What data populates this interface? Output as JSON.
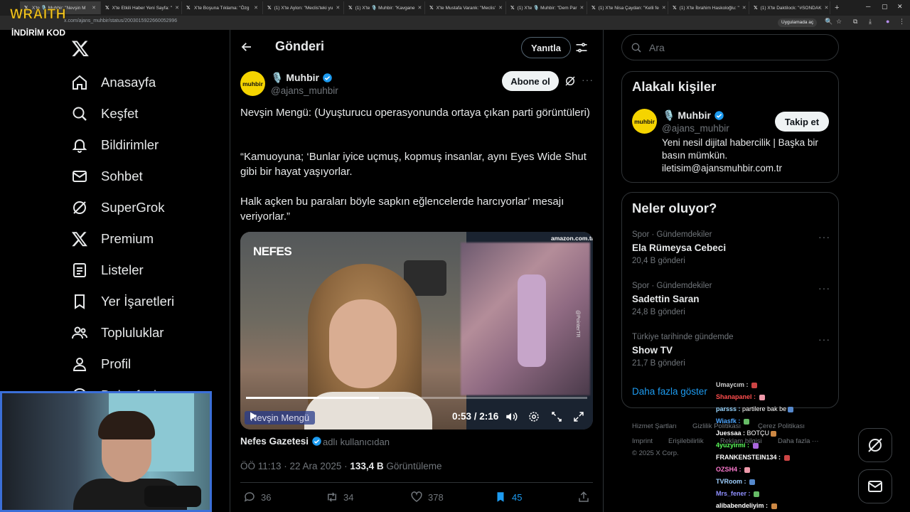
{
  "browser": {
    "tabs": [
      {
        "title": "X'te 🎙️ Muhbir: \"Nevşin M"
      },
      {
        "title": "X'te Etkili Haber Yeni Sayfa: \""
      },
      {
        "title": "X'te Boşuna Tıklama: \"Özg"
      },
      {
        "title": "(1) X'te Aylon: \"Meclis'teki yu"
      },
      {
        "title": "(1) X'te 🎙️ Muhbir: \"Kavgane"
      },
      {
        "title": "X'te Mustafa Varank: \"Meclis'"
      },
      {
        "title": "(1) X'te 🎙️ Muhbir: \"Dem Par"
      },
      {
        "title": "(1) X'te Nisa Çaydan: \"Kelli fe"
      },
      {
        "title": "(1) X'te İbrahim Haskoloğlu: \""
      },
      {
        "title": "(1) X'te Daktilock: \"#SONDAK"
      }
    ],
    "new_tab": "+",
    "url": "x.com/ajans_muhbir/status/2003015922660052996",
    "install_label": "Uygulamada aç"
  },
  "overlay": {
    "brand": "WRAITH",
    "code_label": "İNDİRİM KOD"
  },
  "nav": {
    "items": [
      {
        "label": "Anasayfa",
        "icon": "home-icon"
      },
      {
        "label": "Keşfet",
        "icon": "search-icon"
      },
      {
        "label": "Bildirimler",
        "icon": "bell-icon"
      },
      {
        "label": "Sohbet",
        "icon": "mail-icon"
      },
      {
        "label": "SuperGrok",
        "icon": "grok-icon"
      },
      {
        "label": "Premium",
        "icon": "x-icon"
      },
      {
        "label": "Listeler",
        "icon": "list-icon"
      },
      {
        "label": "Yer İşaretleri",
        "icon": "bookmark-icon"
      },
      {
        "label": "Topluluklar",
        "icon": "people-icon"
      },
      {
        "label": "Profil",
        "icon": "user-icon"
      },
      {
        "label": "Daha fazla",
        "icon": "more-icon"
      }
    ]
  },
  "header": {
    "title": "Gönderi",
    "reply_label": "Yanıtla"
  },
  "post": {
    "author_name": "🎙️ Muhbir",
    "author_handle": "@ajans_muhbir",
    "avatar_text": "muhbir",
    "subscribe_label": "Abone ol",
    "paragraphs": [
      "Nevşin Mengü: (Uyuşturucu operasyonunda ortaya çıkan parti görüntüleri)",
      "“Kamuoyuna; ‘Bunlar iyice uçmuş, kopmuş insanlar, aynı Eyes Wide Shut gibi bir hayat yaşıyorlar.",
      "Halk açken bu paraları böyle sapkın eğlencelerde harcıyorlar’ mesajı veriyorlar.”"
    ],
    "video": {
      "logo": "NEFES",
      "amazon": "amazon.com.tr",
      "watermark": "@PointerTR",
      "speaker": "Nevşin Mengü",
      "time": "0:53 / 2:16",
      "progress": 0.39
    },
    "source_name": "Nefes Gazetesi",
    "source_sub": "adlı kullanıcıdan",
    "time": "ÖÖ 11:13 · 22 Ara 2025 ·",
    "views": "133,4 B",
    "views_label": "Görüntüleme",
    "actions": {
      "replies": "36",
      "reposts": "34",
      "likes": "378",
      "bookmarks": "45"
    }
  },
  "right": {
    "search_placeholder": "Ara",
    "related_title": "Alakalı kişiler",
    "person": {
      "name": "🎙️ Muhbir",
      "handle": "@ajans_muhbir",
      "follow_label": "Takip et",
      "bio": "Yeni nesil dijital habercilik | Başka bir basın mümkün. iletisim@ajansmuhbir.com.tr"
    },
    "trends_title": "Neler oluyor?",
    "trends": [
      {
        "category": "Spor · Gündemdekiler",
        "name": "Ela Rümeysa Cebeci",
        "count": "20,4 B gönderi"
      },
      {
        "category": "Spor · Gündemdekiler",
        "name": "Sadettin Saran",
        "count": "24,8 B gönderi"
      },
      {
        "category": "Türkiye tarihinde gündemde",
        "name": "Show TV",
        "count": "21,7 B gönderi"
      }
    ],
    "show_more": "Daha fazla göster",
    "footer": [
      "Hizmet Şartları",
      "Gizlilik Politikası",
      "Çerez Politikası",
      "Imprint",
      "Erişilebilirlik",
      "Reklam bilgisi",
      "Daha fazla ···",
      "© 2025 X Corp."
    ]
  },
  "chat": [
    {
      "user": "Umaycım :",
      "msg": "",
      "color": "#d0d0d0"
    },
    {
      "user": "Shanapanel :",
      "msg": "",
      "color": "#ff4d4d"
    },
    {
      "user": "parsss :",
      "msg": "partilere bak be",
      "color": "#9ad7ff"
    },
    {
      "user": "Wiasfk :",
      "msg": "",
      "color": "#4da6ff"
    },
    {
      "user": "Juessaa :",
      "msg": "BOTÇU",
      "color": "#ffffff"
    },
    {
      "user": "4yuzyirmi :",
      "msg": "",
      "color": "#5cff5c"
    },
    {
      "user": "FRANKENSTEIN134 :",
      "msg": "",
      "color": "#ffffff"
    },
    {
      "user": "OZSH4 :",
      "msg": "",
      "color": "#ff7ad0"
    },
    {
      "user": "TVRoom :",
      "msg": "",
      "color": "#9fd0ff"
    },
    {
      "user": "Mrs_fener :",
      "msg": "",
      "color": "#8f8fff"
    },
    {
      "user": "alibabendeliyim :",
      "msg": "",
      "color": "#ffffff"
    }
  ]
}
